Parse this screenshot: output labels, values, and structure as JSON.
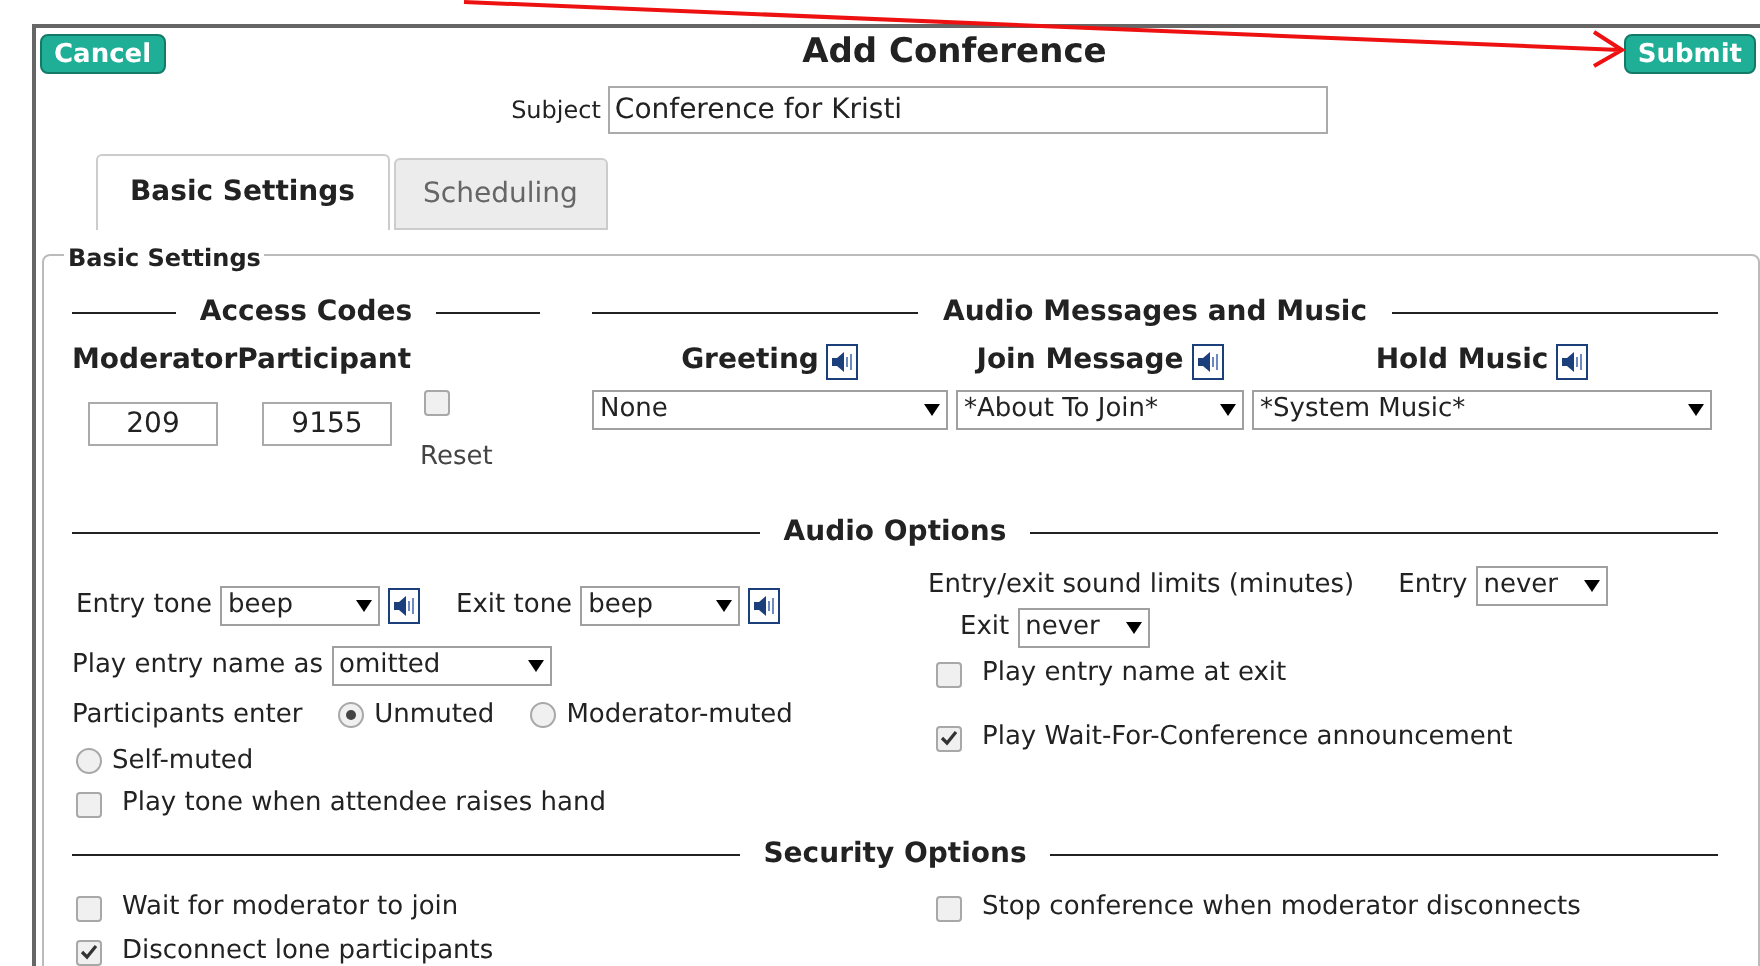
{
  "header": {
    "cancel": "Cancel",
    "title": "Add Conference",
    "submit": "Submit"
  },
  "subject": {
    "label": "Subject",
    "value": "Conference for Kristi"
  },
  "tabs": [
    {
      "label": "Basic Settings",
      "selected": true
    },
    {
      "label": "Scheduling",
      "selected": false
    }
  ],
  "fieldset": {
    "legend": "Basic Settings"
  },
  "access_codes": {
    "heading": "Access Codes",
    "moderator_label": "Moderator",
    "participant_label": "Participant",
    "moderator_value": "209",
    "participant_value": "9155",
    "reset": {
      "label": "Reset",
      "checked": false
    }
  },
  "audio_messages": {
    "heading": "Audio Messages and Music",
    "items": [
      {
        "label": "Greeting",
        "value": "None"
      },
      {
        "label": "Join Message",
        "value": "*About To Join*"
      },
      {
        "label": "Hold Music",
        "value": "*System Music*"
      }
    ]
  },
  "audio_options": {
    "heading": "Audio Options",
    "entry_tone": {
      "label": "Entry tone",
      "value": "beep"
    },
    "exit_tone": {
      "label": "Exit tone",
      "value": "beep"
    },
    "limits": {
      "label": "Entry/exit sound limits (minutes)",
      "entry_label": "Entry",
      "entry_value": "never",
      "exit_label": "Exit",
      "exit_value": "never"
    },
    "entry_name": {
      "label": "Play entry name as",
      "value": "omitted"
    },
    "participants_enter": {
      "label": "Participants enter",
      "options": [
        {
          "label": "Unmuted",
          "selected": true
        },
        {
          "label": "Moderator-muted",
          "selected": false
        },
        {
          "label": "Self-muted",
          "selected": false
        }
      ]
    },
    "raise_hand": {
      "label": "Play tone when attendee raises hand",
      "checked": false
    },
    "name_at_exit": {
      "label": "Play entry name at exit",
      "checked": false
    },
    "wait_announcement": {
      "label": "Play Wait-For-Conference announcement",
      "checked": true
    }
  },
  "security": {
    "heading": "Security Options",
    "left": [
      {
        "label": "Wait for moderator to join",
        "checked": false
      },
      {
        "label": "Disconnect lone participants",
        "checked": true
      }
    ],
    "right": [
      {
        "label": "Stop conference when moderator disconnects",
        "checked": false
      }
    ]
  }
}
